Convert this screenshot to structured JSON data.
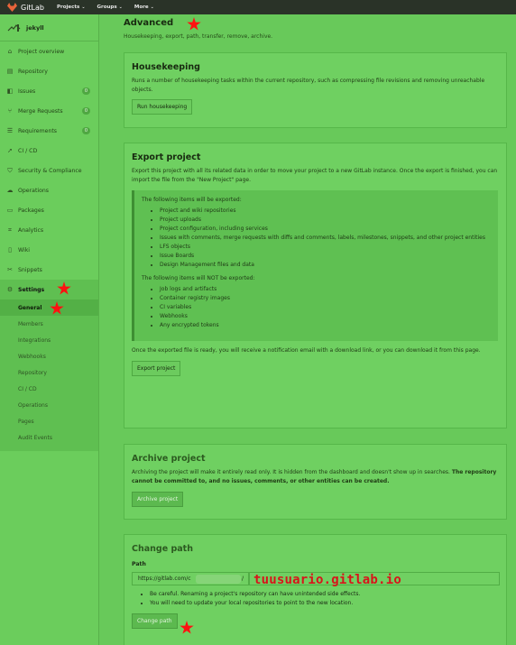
{
  "topbar": {
    "brand": "GitLab",
    "nav": [
      {
        "label": "Projects"
      },
      {
        "label": "Groups"
      },
      {
        "label": "More"
      }
    ]
  },
  "sidebar": {
    "project_name": "jekyll",
    "items": [
      {
        "label": "Project overview",
        "icon": "home-icon"
      },
      {
        "label": "Repository",
        "icon": "doc-icon"
      },
      {
        "label": "Issues",
        "icon": "issues-icon",
        "count": "0"
      },
      {
        "label": "Merge Requests",
        "icon": "merge-icon",
        "count": "0"
      },
      {
        "label": "Requirements",
        "icon": "list-icon",
        "count": "0"
      },
      {
        "label": "CI / CD",
        "icon": "rocket-icon"
      },
      {
        "label": "Security & Compliance",
        "icon": "shield-icon"
      },
      {
        "label": "Operations",
        "icon": "cloud-icon"
      },
      {
        "label": "Packages",
        "icon": "box-icon"
      },
      {
        "label": "Analytics",
        "icon": "chart-icon"
      },
      {
        "label": "Wiki",
        "icon": "book-icon"
      },
      {
        "label": "Snippets",
        "icon": "scissors-icon"
      },
      {
        "label": "Settings",
        "icon": "gear-icon"
      }
    ],
    "settings_sub": [
      {
        "label": "General"
      },
      {
        "label": "Members"
      },
      {
        "label": "Integrations"
      },
      {
        "label": "Webhooks"
      },
      {
        "label": "Repository"
      },
      {
        "label": "CI / CD"
      },
      {
        "label": "Operations"
      },
      {
        "label": "Pages"
      },
      {
        "label": "Audit Events"
      }
    ]
  },
  "advanced": {
    "title": "Advanced",
    "subtitle": "Housekeeping, export, path, transfer, remove, archive."
  },
  "housekeeping": {
    "title": "Housekeeping",
    "desc": "Runs a number of housekeeping tasks within the current repository, such as compressing file revisions and removing unreachable objects.",
    "button": "Run housekeeping"
  },
  "export": {
    "title": "Export project",
    "desc": "Export this project with all its related data in order to move your project to a new GitLab instance. Once the export is finished, you can import the file from the \"New Project\" page.",
    "exported_heading": "The following items will be exported:",
    "exported": [
      "Project and wiki repositories",
      "Project uploads",
      "Project configuration, including services",
      "Issues with comments, merge requests with diffs and comments, labels, milestones, snippets, and other project entities",
      "LFS objects",
      "Issue Boards",
      "Design Management files and data"
    ],
    "not_exported_heading": "The following items will NOT be exported:",
    "not_exported": [
      "Job logs and artifacts",
      "Container registry images",
      "CI variables",
      "Webhooks",
      "Any encrypted tokens"
    ],
    "notice": "Once the exported file is ready, you will receive a notification email with a download link, or you can download it from this page.",
    "button": "Export project"
  },
  "archive": {
    "title": "Archive project",
    "desc_normal": "Archiving the project will make it entirely read only. It is hidden from the dashboard and doesn't show up in searches. ",
    "desc_bold": "The repository cannot be committed to, and no issues, comments, or other entities can be created.",
    "button": "Archive project"
  },
  "change_path": {
    "title": "Change path",
    "label": "Path",
    "prefix": "https://gitlab.com/c",
    "slash": "/",
    "overlay": "tuusuario.gitlab.io",
    "notes": [
      "Be careful. Renaming a project's repository can have unintended side effects.",
      "You will need to update your local repositories to point to the new location."
    ],
    "button": "Change path"
  }
}
